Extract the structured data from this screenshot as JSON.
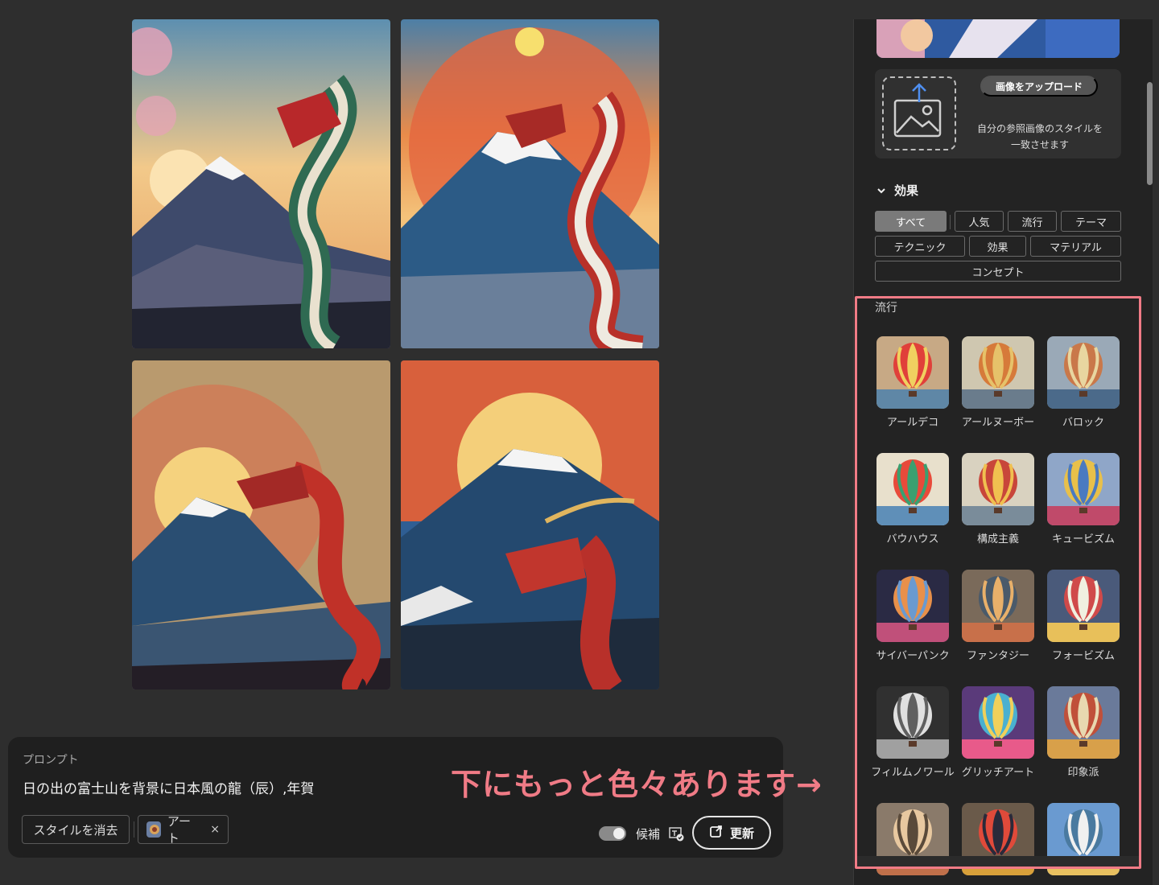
{
  "prompt": {
    "label": "プロンプト",
    "text": "日の出の富士山を背景に日本風の龍（辰）,年賀",
    "clear_style": "スタイルを消去",
    "style_chip": "アート",
    "style_chip_remove": "×",
    "toggle_label": "候補",
    "refresh": "更新"
  },
  "annotation": "下にもっと色々あります→",
  "sidebar": {
    "upload_button": "画像をアップロード",
    "upload_desc_1": "自分の参照画像のスタイルを",
    "upload_desc_2": "一致させます",
    "effects_title": "効果",
    "filters": [
      "すべて",
      "人気",
      "流行",
      "テーマ",
      "テクニック",
      "効果",
      "マテリアル",
      "コンセプト"
    ],
    "section_title": "流行",
    "styles": [
      "アールデコ",
      "アールヌーボー",
      "バロック",
      "バウハウス",
      "構成主義",
      "キュービズム",
      "サイバーパンク",
      "ファンタジー",
      "フォービズム",
      "フィルムノワール",
      "グリッチアート",
      "印象派",
      "",
      "",
      ""
    ]
  },
  "colors": {
    "highlight": "#f07b86",
    "panel": "#1f1f1f",
    "background": "#2e2e2e"
  }
}
